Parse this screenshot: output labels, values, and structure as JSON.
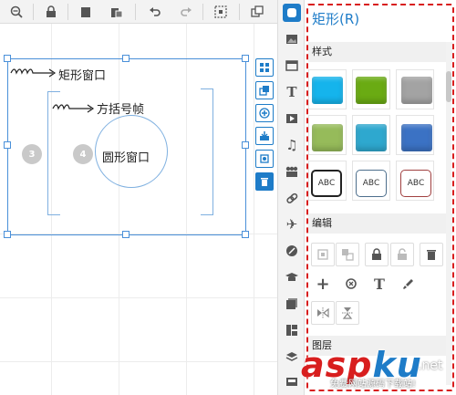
{
  "toolbar": {
    "buttons": [
      "zoom-out-icon",
      "lock-icon",
      "copy-icon",
      "paste-icon",
      "undo-icon",
      "redo-icon",
      "select-area-icon",
      "group-icon"
    ]
  },
  "canvas": {
    "label_rect_window": "矩形窗口",
    "label_bracket_frame": "方括号帧",
    "label_circle_window": "圆形窗口",
    "scribble_1": "ℓℓ",
    "scribble_2": "ℓℓ",
    "badge_3": "3",
    "badge_4": "4"
  },
  "panel": {
    "title": "矩形(R)",
    "style_section": "样式",
    "edit_section": "编辑",
    "layer_section": "图层",
    "swatches": [
      {
        "color": "#15b4ec",
        "kind": "color"
      },
      {
        "color": "#6aab13",
        "kind": "color"
      },
      {
        "color": "#a3a3a3",
        "kind": "color"
      },
      {
        "color": "#96bb5a",
        "kind": "color"
      },
      {
        "color": "#2ea8cf",
        "kind": "color"
      },
      {
        "color": "#3b72c4",
        "kind": "color"
      }
    ],
    "abc_items": [
      {
        "label": "ABC",
        "border": "#222222"
      },
      {
        "label": "ABC",
        "border": "#4d6e8c"
      },
      {
        "label": "ABC",
        "border": "#a04040"
      }
    ]
  },
  "watermark": {
    "brand_a": "asp",
    "brand_b": "ku",
    "net": ".net",
    "sub": "免费网站源码下载站!"
  },
  "colors": {
    "accent": "#1e7cc8",
    "dashed_border": "#d81e1e",
    "watermark_red": "#d81e1e",
    "watermark_blue": "#1e7cc8"
  }
}
